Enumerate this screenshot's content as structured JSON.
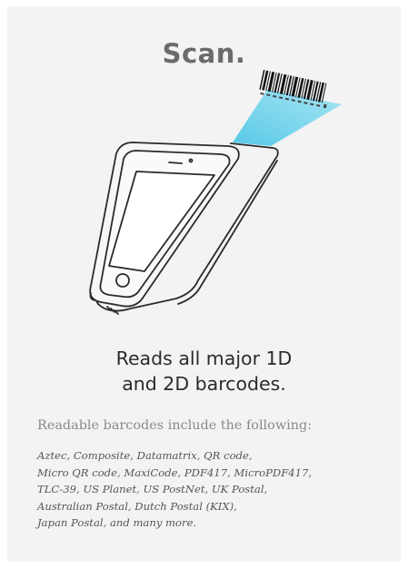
{
  "title": "Scan.",
  "headline": {
    "line1": "Reads all major 1D",
    "line2": "and 2D barcodes."
  },
  "intro": "Readable barcodes include the following:",
  "barcode_list": [
    "Aztec, Composite, Datamatrix, QR code,",
    "Micro QR code, MaxiCode, PDF417, MicroPDF417,",
    "TLC-39, US Planet, US PostNet, UK Postal,",
    "Australian Postal, Dutch Postal (KIX),",
    "Japan Postal, and many more."
  ],
  "colors": {
    "card_background": "#f3f3f3",
    "title": "#6b6b6b",
    "headline": "#2b2b2b",
    "intro": "#8a8a8a",
    "list": "#555555",
    "scan_beam": "#4fc6e6"
  },
  "icons": [
    "barcode-icon",
    "scan-beam",
    "scanner-device-icon"
  ]
}
